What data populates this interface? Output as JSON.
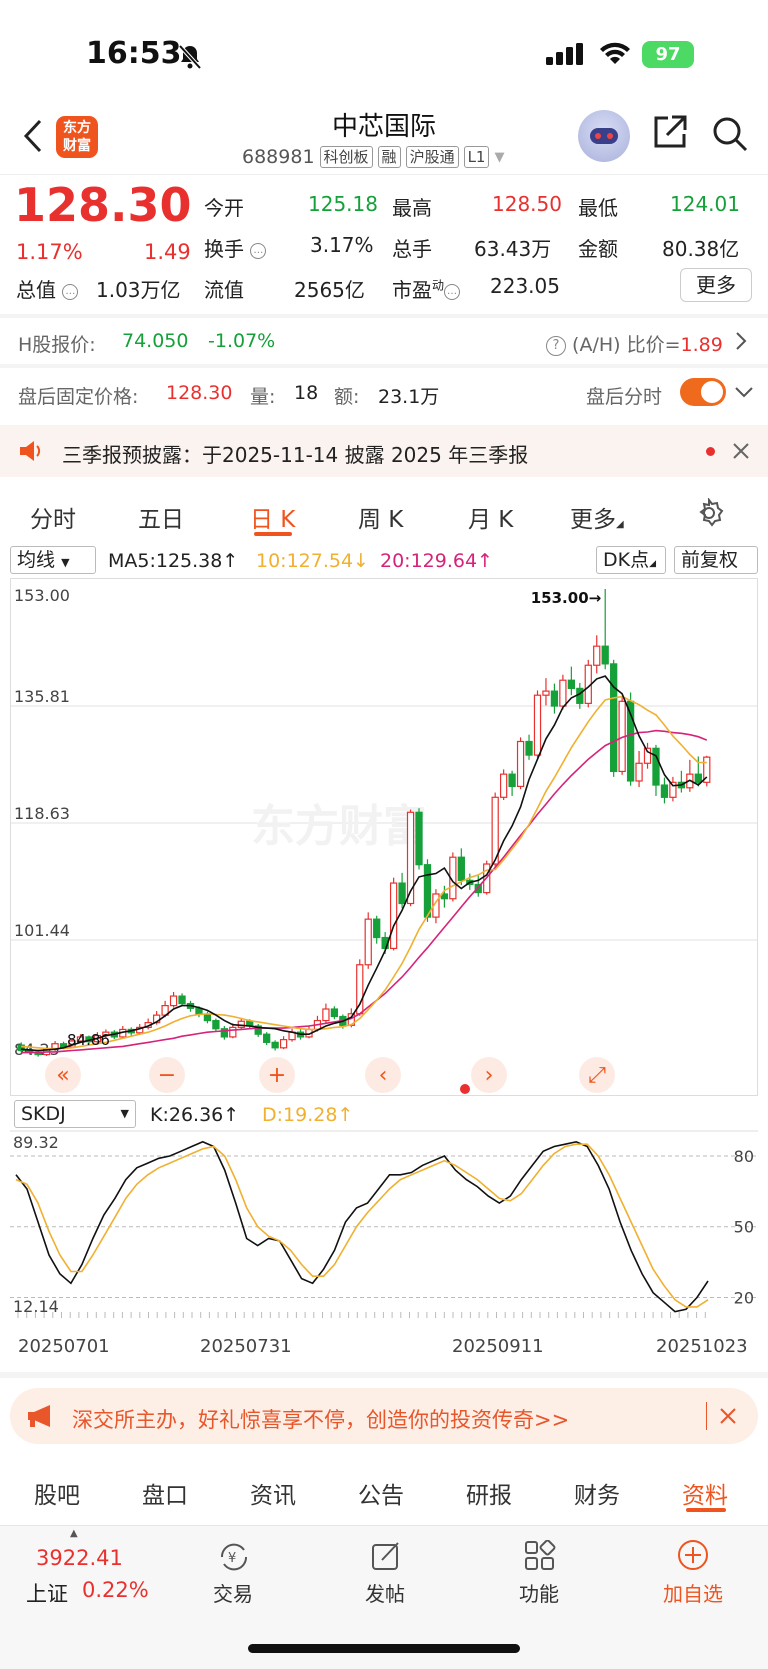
{
  "status": {
    "time": "16:53",
    "battery": "97"
  },
  "header": {
    "logo_line1": "东方",
    "logo_line2": "财富",
    "title": "中芯国际",
    "code": "688981",
    "tags": [
      "科创板",
      "融",
      "沪股通",
      "L1"
    ]
  },
  "quote": {
    "price": "128.30",
    "pct": "1.17%",
    "change": "1.49",
    "open_label": "今开",
    "open": "125.18",
    "high_label": "最高",
    "high": "128.50",
    "low_label": "最低",
    "low": "124.01",
    "turnover_label": "换手",
    "turnover": "3.17%",
    "volume_label": "总手",
    "volume": "63.43万",
    "amount_label": "金额",
    "amount": "80.38亿",
    "mktcap_label": "总值",
    "mktcap": "1.03万亿",
    "float_label": "流值",
    "float": "2565亿",
    "pe_label": "市盈",
    "pe_sup": "动",
    "pe": "223.05",
    "more": "更多"
  },
  "hshare": {
    "label": "H股报价:",
    "price": "74.050",
    "pct": "-1.07%",
    "ratio_label": "(A/H) 比价=",
    "ratio": "1.89"
  },
  "after_hours": {
    "label": "盘后固定价格:",
    "price": "128.30",
    "vol_label": "量:",
    "vol": "18",
    "amt_label": "额:",
    "amt": "23.1万",
    "tick_label": "盘后分时"
  },
  "notice": {
    "text": "三季报预披露：于2025-11-14 披露 2025 年三季报"
  },
  "chart_tabs": [
    "分时",
    "五日",
    "日 K",
    "周 K",
    "月 K",
    "更多"
  ],
  "ma": {
    "selector": "均线",
    "ma5": "MA5:125.38↑",
    "ma10": "10:127.54↓",
    "ma20": "20:129.64↑",
    "dk": "DK点",
    "fq": "前复权"
  },
  "kdj": {
    "selector": "SKDJ",
    "k": "K:26.36↑",
    "d": "D:19.28↑"
  },
  "colors": {
    "up": "#e8312f",
    "down": "#16a03a",
    "accent": "#f0541e",
    "ma5": "#111111",
    "ma10": "#f0b030",
    "ma20": "#d6237a"
  },
  "chart_data": [
    {
      "type": "candlestick",
      "y_ticks": [
        "153.00",
        "135.81",
        "118.63",
        "101.44",
        "84.25"
      ],
      "ylim": [
        84.25,
        153.0
      ],
      "max_label": "153.00→",
      "low_label": "84.86",
      "watermark": "东方财富",
      "candles": [
        [
          86,
          85.2,
          86.4,
          84.9
        ],
        [
          85.3,
          85.0,
          85.6,
          84.6
        ],
        [
          85.0,
          84.6,
          85.3,
          84.3
        ],
        [
          84.6,
          85.4,
          85.7,
          84.4
        ],
        [
          85.4,
          86.2,
          86.6,
          85.1
        ],
        [
          86.2,
          85.7,
          86.5,
          85.4
        ],
        [
          85.7,
          86.6,
          87.0,
          85.5
        ],
        [
          86.6,
          87.2,
          87.6,
          86.3
        ],
        [
          87.2,
          86.5,
          87.4,
          86.2
        ],
        [
          86.5,
          87.4,
          87.9,
          86.3
        ],
        [
          87.4,
          87.9,
          88.3,
          87.0
        ],
        [
          87.9,
          87.2,
          88.2,
          86.9
        ],
        [
          87.2,
          88.3,
          88.8,
          87.0
        ],
        [
          88.3,
          87.8,
          88.6,
          87.4
        ],
        [
          87.8,
          88.6,
          89.1,
          87.5
        ],
        [
          88.6,
          89.3,
          89.9,
          88.3
        ],
        [
          89.3,
          90.4,
          91.0,
          89.0
        ],
        [
          90.4,
          91.8,
          92.5,
          90.1
        ],
        [
          91.8,
          93.2,
          93.8,
          91.5
        ],
        [
          93.2,
          92.1,
          93.6,
          91.7
        ],
        [
          92.1,
          91.4,
          92.5,
          90.9
        ],
        [
          91.4,
          90.5,
          91.7,
          90.1
        ],
        [
          90.5,
          89.6,
          90.9,
          89.2
        ],
        [
          89.6,
          88.4,
          89.9,
          88.0
        ],
        [
          88.4,
          87.2,
          88.8,
          86.8
        ],
        [
          87.2,
          88.6,
          89.2,
          87.0
        ],
        [
          88.6,
          89.5,
          90.0,
          88.2
        ],
        [
          89.5,
          88.8,
          89.8,
          88.4
        ],
        [
          88.8,
          87.6,
          89.1,
          87.2
        ],
        [
          87.6,
          86.4,
          87.9,
          86.0
        ],
        [
          86.4,
          85.6,
          86.7,
          85.2
        ],
        [
          85.6,
          86.8,
          87.3,
          85.4
        ],
        [
          86.8,
          87.9,
          88.4,
          86.5
        ],
        [
          87.9,
          87.2,
          88.3,
          86.8
        ],
        [
          87.2,
          88.3,
          88.9,
          87.0
        ],
        [
          88.3,
          89.6,
          90.3,
          88.0
        ],
        [
          89.6,
          91.3,
          92.1,
          89.3
        ],
        [
          91.3,
          90.2,
          91.7,
          89.8
        ],
        [
          90.2,
          88.9,
          90.5,
          88.4
        ],
        [
          88.9,
          90.6,
          91.4,
          88.6
        ],
        [
          90.6,
          97.8,
          98.6,
          90.3
        ],
        [
          97.8,
          104.5,
          105.5,
          97.2
        ],
        [
          104.5,
          101.8,
          105.0,
          100.9
        ],
        [
          101.8,
          100.2,
          102.6,
          99.4
        ],
        [
          100.2,
          109.8,
          110.6,
          99.9
        ],
        [
          109.8,
          106.8,
          111.3,
          106.1
        ],
        [
          106.8,
          120.2,
          120.6,
          106.4
        ],
        [
          120.2,
          112.5,
          120.8,
          111.8
        ],
        [
          112.5,
          104.8,
          113.3,
          104.1
        ],
        [
          104.8,
          108.2,
          108.9,
          103.9
        ],
        [
          108.2,
          107.5,
          109.4,
          106.2
        ],
        [
          107.5,
          113.6,
          114.3,
          107.1
        ],
        [
          113.6,
          110.2,
          114.9,
          109.5
        ],
        [
          110.2,
          109.6,
          111.2,
          108.8
        ],
        [
          109.6,
          108.4,
          110.9,
          107.8
        ],
        [
          108.4,
          112.6,
          113.1,
          108.1
        ],
        [
          112.6,
          122.4,
          123.1,
          112.2
        ],
        [
          122.4,
          125.8,
          126.5,
          122.0
        ],
        [
          125.8,
          124.0,
          126.3,
          122.6
        ],
        [
          124.0,
          130.6,
          131.2,
          123.6
        ],
        [
          130.6,
          128.6,
          131.6,
          127.9
        ],
        [
          128.6,
          137.4,
          138.1,
          128.2
        ],
        [
          137.4,
          138.0,
          139.9,
          135.9
        ],
        [
          138.0,
          135.8,
          139.1,
          134.7
        ],
        [
          135.8,
          139.6,
          140.4,
          135.3
        ],
        [
          139.6,
          138.4,
          141.6,
          137.4
        ],
        [
          138.4,
          136.2,
          139.2,
          135.4
        ],
        [
          136.2,
          141.8,
          142.6,
          135.6
        ],
        [
          141.8,
          144.6,
          146.2,
          140.6
        ],
        [
          144.6,
          142.0,
          153.0,
          141.2
        ],
        [
          142.0,
          126.2,
          142.6,
          125.4
        ],
        [
          126.2,
          136.5,
          137.2,
          125.7
        ],
        [
          136.5,
          124.8,
          137.8,
          124.1
        ],
        [
          124.8,
          127.4,
          129.2,
          123.9
        ],
        [
          127.4,
          129.6,
          130.4,
          126.6
        ],
        [
          129.6,
          124.2,
          130.1,
          122.6
        ],
        [
          124.2,
          122.4,
          125.3,
          121.5
        ],
        [
          122.4,
          124.6,
          125.4,
          121.8
        ],
        [
          124.6,
          123.8,
          126.3,
          123.1
        ],
        [
          123.8,
          125.8,
          127.9,
          123.2
        ],
        [
          125.8,
          124.6,
          128.4,
          124.0
        ],
        [
          124.6,
          128.3,
          128.5,
          124.0
        ]
      ],
      "ma5": [
        85.4,
        85.3,
        85.2,
        85.3,
        85.4,
        85.6,
        86.0,
        86.4,
        86.7,
        87.0,
        87.4,
        87.6,
        87.9,
        88.1,
        88.4,
        88.8,
        89.4,
        90.3,
        91.3,
        91.8,
        91.8,
        91.5,
        91.1,
        90.4,
        89.6,
        89.0,
        88.9,
        88.8,
        88.6,
        88.5,
        88.4,
        88.1,
        87.9,
        87.6,
        87.6,
        88.2,
        88.8,
        89.2,
        89.5,
        90.1,
        92.0,
        94.8,
        97.3,
        99.9,
        103.5,
        105.8,
        108.6,
        110.7,
        111.0,
        111.2,
        112.0,
        110.0,
        109.0,
        109.9,
        110.2,
        111.0,
        113.2,
        116.0,
        118.2,
        121.0,
        125.0,
        128.0,
        131.0,
        133.0,
        135.6,
        137.0,
        137.6,
        138.6,
        139.8,
        140.2,
        138.6,
        137.6,
        134.6,
        131.4,
        129.1,
        128.5,
        125.7,
        124.1,
        124.2,
        124.9,
        124.2,
        125.4
      ],
      "ma10": [
        85.8,
        85.7,
        85.6,
        85.5,
        85.5,
        85.5,
        85.6,
        85.8,
        86.0,
        86.2,
        86.4,
        86.7,
        87.0,
        87.3,
        87.6,
        87.9,
        88.3,
        88.8,
        89.4,
        89.9,
        90.3,
        90.5,
        90.6,
        90.5,
        90.4,
        90.2,
        89.9,
        89.6,
        89.4,
        89.2,
        89.0,
        88.8,
        88.6,
        88.4,
        88.3,
        88.3,
        88.4,
        88.6,
        88.7,
        89.0,
        89.9,
        91.2,
        92.6,
        94.1,
        96.0,
        98.0,
        100.4,
        103.0,
        105.0,
        107.0,
        108.7,
        109.4,
        110.0,
        110.6,
        111.0,
        111.7,
        111.8,
        113.2,
        114.8,
        116.4,
        118.4,
        120.8,
        123.3,
        125.3,
        127.5,
        129.7,
        131.6,
        133.5,
        135.2,
        136.7,
        137.0,
        137.2,
        136.6,
        136.0,
        135.2,
        134.5,
        133.0,
        131.4,
        130.1,
        128.7,
        127.5,
        127.5
      ],
      "ma20": [
        84.9,
        84.9,
        84.9,
        85.0,
        85.0,
        85.1,
        85.2,
        85.3,
        85.4,
        85.5,
        85.6,
        85.7,
        85.8,
        86.0,
        86.2,
        86.4,
        86.6,
        86.8,
        87.0,
        87.3,
        87.5,
        87.7,
        87.9,
        88.0,
        88.1,
        88.2,
        88.3,
        88.4,
        88.5,
        88.5,
        88.5,
        88.5,
        88.6,
        88.7,
        88.8,
        89.0,
        89.2,
        89.4,
        89.6,
        89.9,
        90.6,
        91.6,
        92.6,
        93.6,
        94.8,
        96.0,
        97.4,
        98.9,
        100.3,
        101.8,
        103.3,
        104.8,
        106.3,
        107.8,
        109.2,
        110.6,
        112.1,
        113.6,
        115.2,
        116.8,
        118.3,
        119.9,
        121.4,
        122.9,
        124.3,
        125.6,
        126.8,
        128.0,
        129.0,
        130.0,
        130.6,
        131.2,
        131.6,
        131.9,
        132.0,
        132.2,
        132.1,
        131.9,
        131.8,
        131.6,
        131.3,
        130.8
      ]
    },
    {
      "type": "line",
      "y_ticks": [
        "89.32",
        "12.14"
      ],
      "ylim": [
        12.14,
        89.32
      ],
      "right_ticks": [
        "80",
        "50",
        "20"
      ],
      "dates": [
        "20250701",
        "20250731",
        "20250911",
        "20251023"
      ],
      "series": [
        {
          "name": "K",
          "values": [
            72,
            66,
            52,
            38,
            30,
            26,
            34,
            45,
            55,
            62,
            70,
            75,
            77,
            79,
            80,
            82,
            84,
            86,
            84,
            74,
            60,
            45,
            42,
            45,
            44,
            36,
            28,
            26,
            32,
            40,
            52,
            58,
            60,
            66,
            72,
            72,
            73,
            76,
            78,
            80,
            74,
            70,
            67,
            63,
            60,
            63,
            70,
            76,
            82,
            84,
            85,
            86,
            84,
            76,
            66,
            52,
            40,
            30,
            22,
            18,
            14,
            15,
            20,
            27
          ]
        },
        {
          "name": "D",
          "values": [
            70,
            68,
            60,
            48,
            38,
            31,
            31,
            38,
            46,
            54,
            62,
            68,
            72,
            75,
            77,
            79,
            81,
            83,
            84,
            80,
            70,
            58,
            50,
            46,
            44,
            40,
            34,
            29,
            29,
            34,
            42,
            50,
            56,
            61,
            66,
            70,
            72,
            74,
            76,
            78,
            76,
            73,
            70,
            66,
            62,
            61,
            64,
            70,
            76,
            81,
            84,
            85,
            85,
            80,
            72,
            62,
            52,
            42,
            32,
            25,
            19,
            16,
            16,
            19
          ]
        }
      ]
    }
  ],
  "banner": {
    "text": "深交所主办，好礼惊喜享不停，创造你的投资传奇>>"
  },
  "bottom_tabs": [
    "股吧",
    "盘口",
    "资讯",
    "公告",
    "研报",
    "财务",
    "资料"
  ],
  "nav": {
    "index_value": "3922.41",
    "index_name": "上证",
    "index_pct": "0.22%",
    "trade": "交易",
    "post": "发帖",
    "func": "功能",
    "add": "加自选"
  }
}
